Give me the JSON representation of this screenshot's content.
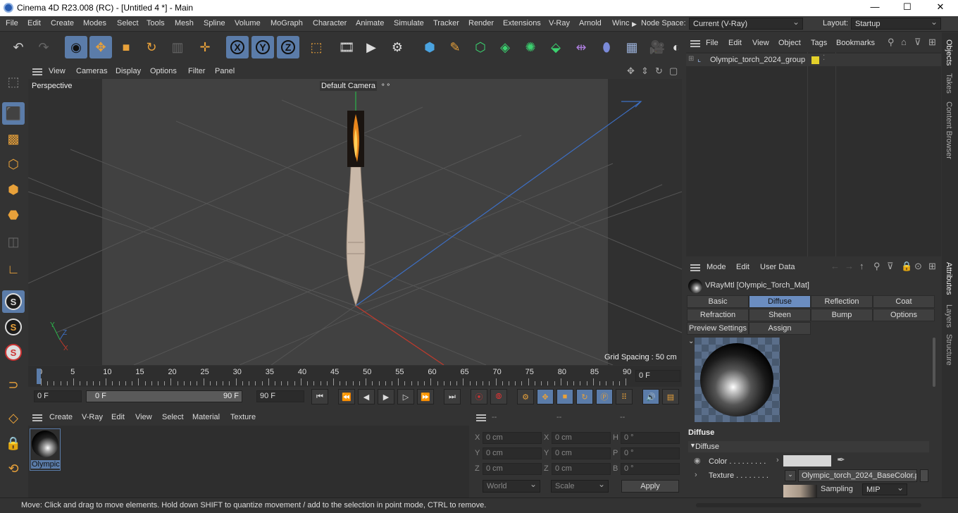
{
  "titlebar": {
    "title": "Cinema 4D R23.008 (RC) - [Untitled 4 *] - Main",
    "min": "—",
    "max": "☐",
    "close": "✕"
  },
  "menus": [
    "File",
    "Edit",
    "Create",
    "Modes",
    "Select",
    "Tools",
    "Mesh",
    "Spline",
    "Volume",
    "MoGraph",
    "Character",
    "Animate",
    "Simulate",
    "Tracker",
    "Render",
    "Extensions",
    "V-Ray",
    "Arnold",
    "Winc"
  ],
  "nodespace": {
    "label": "Node Space:",
    "value": "Current (V-Ray)"
  },
  "layout": {
    "label": "Layout:",
    "value": "Startup"
  },
  "toolbar": {
    "x": "X",
    "y": "Y",
    "z": "Z"
  },
  "viewport": {
    "menu": [
      "View",
      "Cameras",
      "Display",
      "Options",
      "Filter",
      "Panel"
    ],
    "name": "Perspective",
    "camera": "Default Camera",
    "grid": "Grid Spacing : 50 cm",
    "axis_y": "Y",
    "axis_z": "Z",
    "axis_x": "X"
  },
  "timeline": {
    "ticks": [
      "0",
      "5",
      "10",
      "15",
      "20",
      "25",
      "30",
      "35",
      "40",
      "45",
      "50",
      "55",
      "60",
      "65",
      "70",
      "75",
      "80",
      "85",
      "90"
    ],
    "current": "0 F"
  },
  "playbar": {
    "start": "0 F",
    "range_start": "0 F",
    "range_end": "90 F",
    "end": "90 F"
  },
  "materials": {
    "menu": [
      "Create",
      "V-Ray",
      "Edit",
      "View",
      "Select",
      "Material",
      "Texture"
    ],
    "item": "Olympic"
  },
  "coords": {
    "head": [
      "--",
      "--",
      "--"
    ],
    "rows": [
      [
        "X",
        "0 cm",
        "X",
        "0 cm",
        "H",
        "0 °"
      ],
      [
        "Y",
        "0 cm",
        "Y",
        "0 cm",
        "P",
        "0 °"
      ],
      [
        "Z",
        "0 cm",
        "Z",
        "0 cm",
        "B",
        "0 °"
      ]
    ],
    "world": "World",
    "scale": "Scale",
    "apply": "Apply"
  },
  "objects": {
    "menu": [
      "File",
      "Edit",
      "View",
      "Object",
      "Tags",
      "Bookmarks"
    ],
    "item": "Olympic_torch_2024_group"
  },
  "attributes": {
    "menu": [
      "Mode",
      "Edit",
      "User Data"
    ],
    "material": "VRayMtl [Olympic_Torch_Mat]",
    "tabs1": [
      "Basic",
      "Diffuse",
      "Reflection",
      "Coat"
    ],
    "tabs2": [
      "Refraction",
      "Sheen",
      "Bump",
      "Options"
    ],
    "tabs3": [
      "Preview Settings",
      "Assign"
    ],
    "section": "Diffuse",
    "group": "Diffuse",
    "color_label": "Color . . . . . . . . .",
    "texture_label": "Texture . . . . . . . .",
    "texture_value": "Olympic_torch_2024_BaseColor.p",
    "sampling_label": "Sampling",
    "sampling_value": "MIP"
  },
  "side_tabs": [
    "Objects",
    "Takes",
    "Content Browser",
    "Attributes",
    "Layers",
    "Structure"
  ],
  "status": "Move: Click and drag to move elements. Hold down SHIFT to quantize movement / add to the selection in point mode, CTRL to remove.",
  "colors": {
    "accent": "#5b7ca9",
    "tab_selected": "#6b8dc0",
    "tag_yellow": "#e3d02a"
  }
}
